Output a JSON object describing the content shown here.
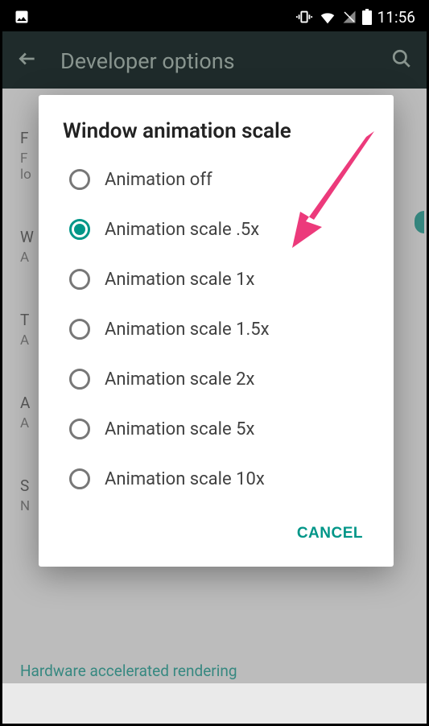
{
  "statusBar": {
    "time": "11:56"
  },
  "appBar": {
    "title": "Developer options"
  },
  "dialog": {
    "title": "Window animation scale",
    "options": [
      {
        "label": "Animation off",
        "selected": false
      },
      {
        "label": "Animation scale .5x",
        "selected": true
      },
      {
        "label": "Animation scale 1x",
        "selected": false
      },
      {
        "label": "Animation scale 1.5x",
        "selected": false
      },
      {
        "label": "Animation scale 2x",
        "selected": false
      },
      {
        "label": "Animation scale 5x",
        "selected": false
      },
      {
        "label": "Animation scale 10x",
        "selected": false
      }
    ],
    "cancel": "CANCEL"
  },
  "background": {
    "items": [
      {
        "title": "F",
        "sub": "F\nlo"
      },
      {
        "title": "W",
        "sub": "A"
      },
      {
        "title": "T",
        "sub": "A"
      },
      {
        "title": "A",
        "sub": "A"
      },
      {
        "title": "S",
        "sub": "N"
      }
    ],
    "bottomText": "Hardware accelerated rendering"
  }
}
